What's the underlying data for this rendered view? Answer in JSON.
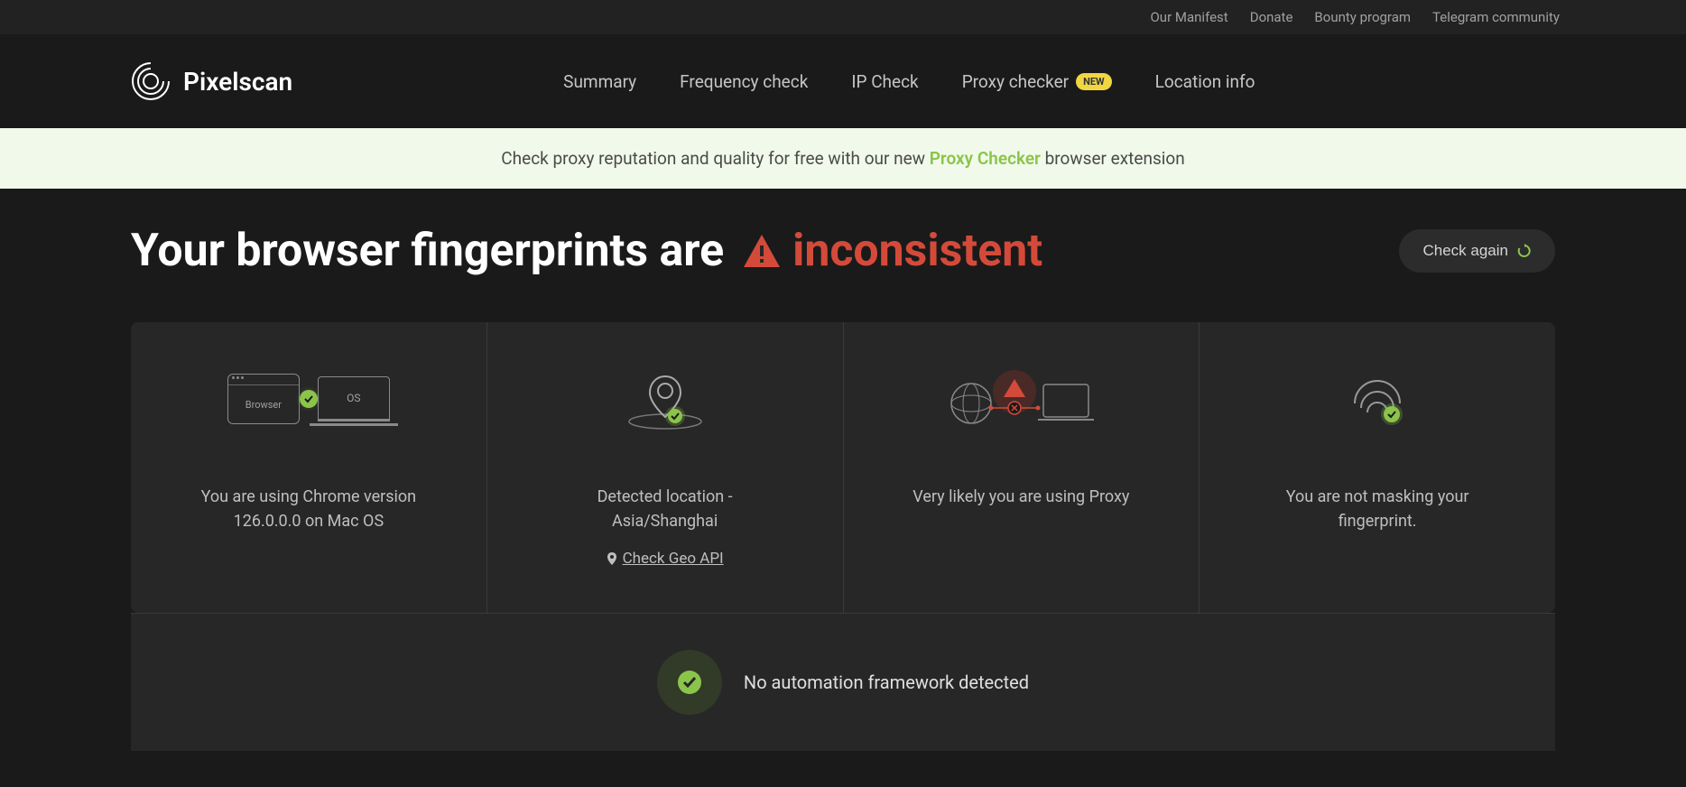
{
  "topbar": {
    "links": [
      "Our Manifest",
      "Donate",
      "Bounty program",
      "Telegram community"
    ]
  },
  "brand": {
    "name": "Pixelscan"
  },
  "nav": {
    "items": [
      {
        "label": "Summary"
      },
      {
        "label": "Frequency check"
      },
      {
        "label": "IP Check"
      },
      {
        "label": "Proxy checker",
        "badge": "NEW"
      },
      {
        "label": "Location info"
      }
    ]
  },
  "promo": {
    "pre": "Check proxy reputation and quality for free with our new ",
    "link": "Proxy Checker",
    "post": " browser extension"
  },
  "result": {
    "heading_pre": "Your browser fingerprints are",
    "status": "inconsistent",
    "check_again": "Check again"
  },
  "cards": {
    "browser": {
      "browser_label": "Browser",
      "os_label": "OS",
      "text": "You are using Chrome version 126.0.0.0 on Mac OS"
    },
    "location": {
      "text": "Detected location - Asia/Shanghai",
      "geo_link": "Check Geo API"
    },
    "proxy": {
      "text": "Very likely you are using Proxy"
    },
    "masking": {
      "text": "You are not masking your fingerprint."
    }
  },
  "automation": {
    "text": "No automation framework detected"
  },
  "colors": {
    "accent_green": "#8bc44a",
    "accent_red": "#d44a3a"
  }
}
